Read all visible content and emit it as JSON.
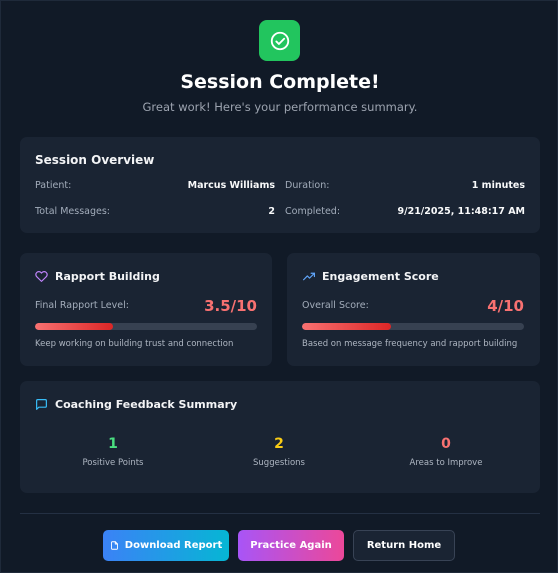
{
  "header": {
    "title": "Session Complete!",
    "subtitle": "Great work! Here's your performance summary."
  },
  "overview": {
    "title": "Session Overview",
    "patient_label": "Patient:",
    "patient_value": "Marcus Williams",
    "messages_label": "Total Messages:",
    "messages_value": "2",
    "duration_label": "Duration:",
    "duration_value": "1 minutes",
    "completed_label": "Completed:",
    "completed_value": "9/21/2025, 11:48:17 AM"
  },
  "rapport": {
    "title": "Rapport Building",
    "label": "Final Rapport Level:",
    "score": "3.5/10",
    "level": 0.35,
    "note": "Keep working on building trust and connection"
  },
  "engagement": {
    "title": "Engagement Score",
    "label": "Overall Score:",
    "score": "4/10",
    "level": 0.4,
    "note": "Based on message frequency and rapport building"
  },
  "coaching": {
    "title": "Coaching Feedback Summary",
    "positive_count": "1",
    "positive_label": "Positive Points",
    "suggestions_count": "2",
    "suggestions_label": "Suggestions",
    "improve_count": "0",
    "improve_label": "Areas to Improve"
  },
  "actions": {
    "download_label": "Download Report",
    "practice_label": "Practice Again",
    "home_label": "Return Home"
  },
  "colors": {
    "success": "#22c55e",
    "positive": "#4ade80",
    "suggestion": "#facc15",
    "improve": "#f87171",
    "score": "#f87171"
  },
  "icons": {
    "header": "check-circle-icon",
    "rapport": "heart-icon",
    "engagement": "trending-up-icon",
    "coaching": "message-square-icon",
    "download": "file-icon"
  }
}
